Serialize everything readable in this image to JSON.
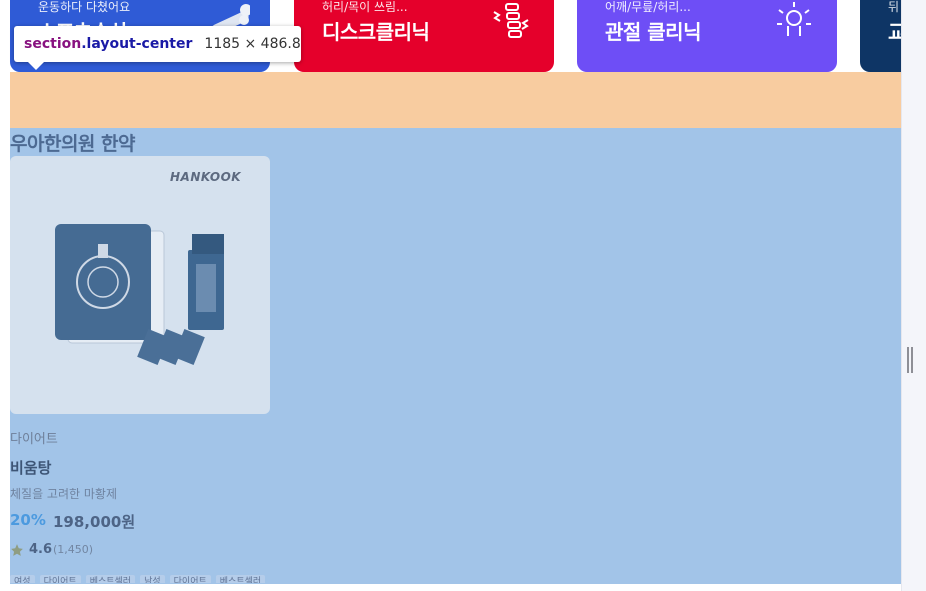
{
  "banners": [
    {
      "subtitle": "운동하다 다쳤어요",
      "title": "스포츠손상",
      "color": "#2f5bd6",
      "icon": "bone-icon"
    },
    {
      "subtitle": "허리/목이 쓰림...",
      "title": "디스크클리닉",
      "color": "#e5002b",
      "icon": "spine-icon"
    },
    {
      "subtitle": "어깨/무릎/허리...",
      "title": "관절 클리닉",
      "color": "#6e4ef6",
      "icon": "joint-icon"
    },
    {
      "subtitle": "뒤",
      "title": "교",
      "color": "#0e3565",
      "icon": ""
    }
  ],
  "tooltip": {
    "element": "section",
    "class_name": ".layout-center",
    "dimensions": "1185 × 486.8"
  },
  "section": {
    "title": "우아한의원 한약"
  },
  "product": {
    "brand": "HANKOOK",
    "category": "다이어트",
    "name": "비움탕",
    "description": "체질을 고려한 마황제",
    "discount": "20%",
    "price": "198,000원",
    "rating": "4.6",
    "reviews": "(1,450)",
    "tags": [
      "여성",
      "다이어트",
      "베스트셀러",
      "남성",
      "다이어트",
      "베스트셀러"
    ]
  },
  "colors": {
    "overlay": "#a2c4e8",
    "peach": "#f8cca0",
    "discount": "#4c9adf"
  }
}
